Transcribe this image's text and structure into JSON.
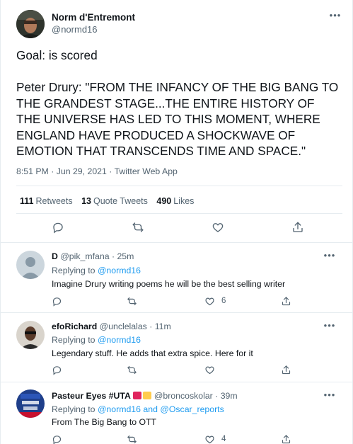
{
  "main_tweet": {
    "author_name": "Norm d'Entremont",
    "author_handle": "@normd16",
    "text": "Goal: is scored\n\nPeter Drury: \"FROM THE INFANCY OF THE BIG BANG TO THE GRANDEST STAGE...THE ENTIRE HISTORY OF THE UNIVERSE HAS LED TO THIS MOMENT, WHERE ENGLAND HAVE PRODUCED A SHOCKWAVE OF EMOTION THAT TRANSCENDS TIME AND SPACE.\"",
    "timestamp": "8:51 PM · Jun 29, 2021",
    "separator": " · ",
    "source": "Twitter Web App",
    "stats": {
      "retweets_count": "111",
      "retweets_label": "Retweets",
      "quote_count": "13",
      "quote_label": "Quote Tweets",
      "likes_count": "490",
      "likes_label": "Likes"
    },
    "more_glyph": "•••"
  },
  "replies": [
    {
      "name": "D",
      "handle": "@pik_mfana",
      "time": "· 25m",
      "replying_prefix": "Replying to",
      "replying_to": [
        "@normd16"
      ],
      "text": "Imagine Drury writing poems he will be the best selling writer",
      "like_count": "6",
      "avatar_icon": "default-profile-icon"
    },
    {
      "name": "efoRichard",
      "handle": "@unclelalas",
      "time": "· 11m",
      "replying_prefix": "Replying to",
      "replying_to": [
        "@normd16"
      ],
      "text": "Legendary stuff. He adds that extra spice. Here for it",
      "like_count": "",
      "avatar_icon": "profile-photo"
    },
    {
      "name": "Pasteur Eyes #UTA",
      "handle": "@broncoskolar",
      "time": "· 39m",
      "replying_prefix": "Replying to",
      "replying_to": [
        "@normd16",
        "@Oscar_reports"
      ],
      "replying_joiner": "and",
      "text": "From The Big Bang to OTT",
      "like_count": "4",
      "avatar_icon": "profile-photo"
    }
  ],
  "colors": {
    "link": "#1d9bf0",
    "muted": "#536471",
    "text": "#0f1419",
    "divider": "#e6ecf0",
    "flag_red": "#e0245e",
    "flag_yellow": "#ffcc4d"
  },
  "icons": [
    "more-icon",
    "reply-icon",
    "retweet-icon",
    "like-icon",
    "share-icon"
  ]
}
